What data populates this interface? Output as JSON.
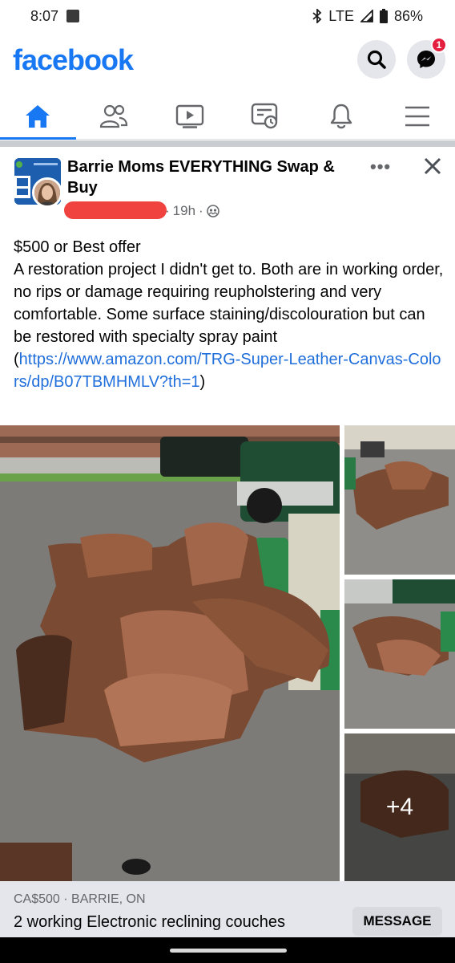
{
  "status_bar": {
    "time": "8:07",
    "network": "LTE",
    "battery": "86%"
  },
  "header": {
    "logo": "facebook",
    "messenger_badge": "1",
    "brand_color": "#1877f2"
  },
  "tabs": [
    {
      "name": "home-icon",
      "active": true
    },
    {
      "name": "friends-icon",
      "active": false
    },
    {
      "name": "watch-icon",
      "active": false
    },
    {
      "name": "feeds-icon",
      "active": false
    },
    {
      "name": "notifications-bell-icon",
      "active": false
    },
    {
      "name": "menu-icon",
      "active": false
    }
  ],
  "post": {
    "group_name": "Barrie Moms EVERYTHING Swap & Buy",
    "time_ago": "19h",
    "audience_icon": "group-audience-icon",
    "price_line": "$500 or Best offer",
    "description": "A restoration project I didn't get to.  Both are in working order, no rips or damage requiring reupholstering and very comfortable. Some surface staining/discolouration but can be restored with specialty spray paint",
    "link_open": "(",
    "link": "https://www.amazon.com/TRG-Super-Leather-Canvas-Colors/dp/B07TBMHMLV?th=1",
    "link_close": ")",
    "more_photos": "+4"
  },
  "listing": {
    "price_location": "CA$500 · BARRIE, ON",
    "title": "2 working Electronic reclining couches",
    "message_button": "MESSAGE"
  }
}
